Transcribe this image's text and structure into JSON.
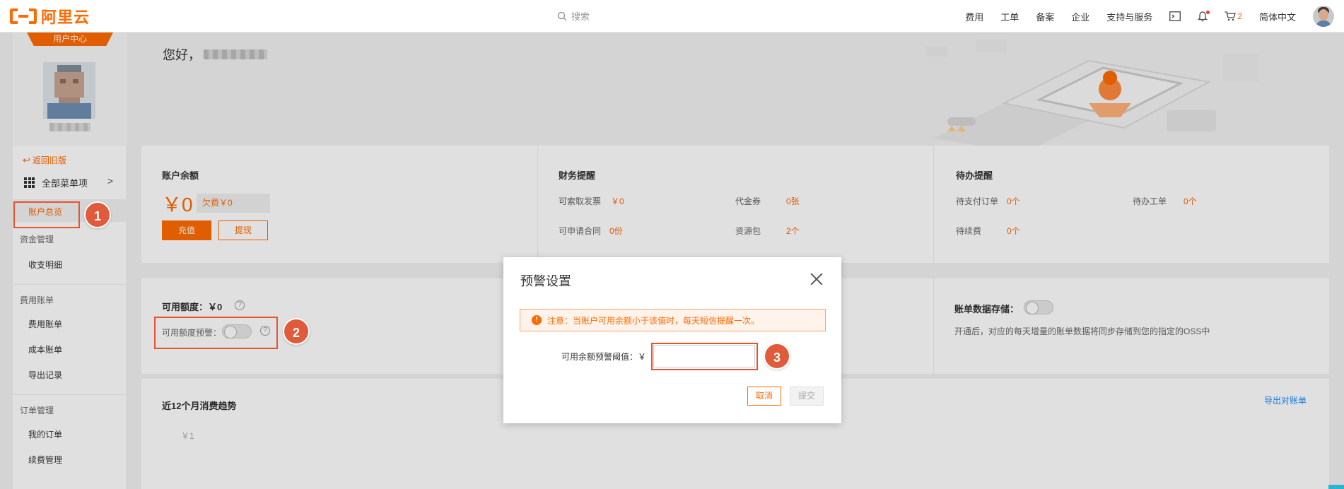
{
  "header": {
    "logo_text": "阿里云",
    "search_placeholder": "搜索",
    "nav": [
      "费用",
      "工单",
      "备案",
      "企业",
      "支持与服务"
    ],
    "cart_count": "2",
    "language": "简体中文"
  },
  "sidebar": {
    "user_center_label": "用户中心",
    "back_label": "返回旧版",
    "all_menu_label": "全部菜单项",
    "active_item": "账户总览",
    "groups": [
      {
        "title": "资金管理",
        "items": [
          "收支明细"
        ]
      },
      {
        "title": "费用账单",
        "items": [
          "费用账单",
          "成本账单",
          "导出记录"
        ]
      },
      {
        "title": "订单管理",
        "items": [
          "我的订单",
          "续费管理"
        ]
      }
    ]
  },
  "main": {
    "greeting": "您好，",
    "balance": {
      "title": "账户余额",
      "amount": "￥0",
      "arrears": "欠费￥0",
      "recharge_label": "充值",
      "withdraw_label": "提现"
    },
    "finance": {
      "title": "财务提醒",
      "items": [
        {
          "label": "可索取发票",
          "value": "￥0"
        },
        {
          "label": "代金券",
          "value": "0张"
        },
        {
          "label": "可申请合同",
          "value": "0份"
        },
        {
          "label": "资源包",
          "value": "2个"
        }
      ]
    },
    "todo": {
      "title": "待办提醒",
      "items": [
        {
          "label": "待支付订单",
          "value": "0个"
        },
        {
          "label": "待办工单",
          "value": "0个"
        },
        {
          "label": "待续费",
          "value": "0个"
        }
      ]
    },
    "credit": {
      "title": "可用额度：￥0",
      "alert_label": "可用额度预警："
    },
    "bill_storage": {
      "title": "账单数据存储：",
      "desc": "开通后，对应的每天增量的账单数据将同步存储到您的指定的OSS中"
    },
    "trend": {
      "title": "近12个月消费趋势",
      "export_label": "导出对账单",
      "y_tick": "￥1"
    }
  },
  "dialog": {
    "title": "预警设置",
    "notice": "注意：当账户可用余额小于该值时，每天短信提醒一次。",
    "field_label": "可用余额预警阈值：￥",
    "field_value": "",
    "cancel_label": "取消",
    "submit_label": "提交"
  },
  "annotations": [
    "1",
    "2",
    "3"
  ],
  "colors": {
    "accent": "#ff6a00",
    "annotation": "#e05b3b"
  }
}
